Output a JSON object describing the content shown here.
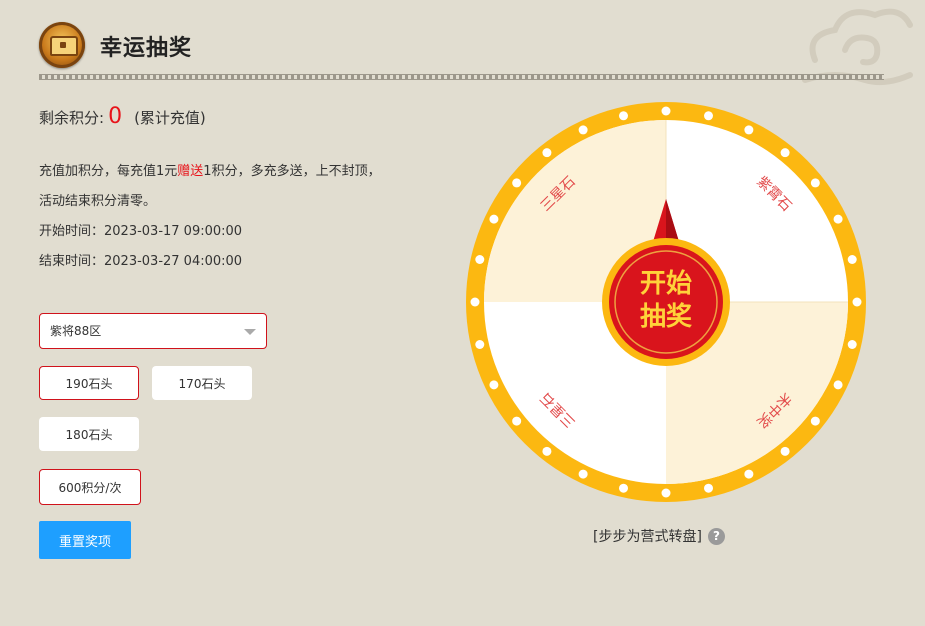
{
  "header": {
    "title": "幸运抽奖",
    "icon": "treasure-chest-icon"
  },
  "points": {
    "label": "剩余积分:",
    "value": "0",
    "note": "(累计充值)"
  },
  "rules": {
    "line1_a": "充值加积分，每充值1元",
    "line1_highlight": "赠送",
    "line1_b": "1积分，多充多送，上不封顶，",
    "line2": "活动结束积分清零。",
    "start_time": "开始时间：2023-03-17 09:00:00",
    "end_time": "结束时间：2023-03-27 04:00:00"
  },
  "server_select": {
    "value": "紫将88区"
  },
  "options": [
    {
      "label": "190石头",
      "selected": true
    },
    {
      "label": "170石头",
      "selected": false
    },
    {
      "label": "180石头",
      "selected": false
    }
  ],
  "cost": {
    "label": "600积分/次"
  },
  "reset_button": {
    "label": "重置奖项"
  },
  "wheel": {
    "prizes": [
      "三星石",
      "紫霄石",
      "未中奖",
      "三星石"
    ],
    "start_line1": "开始",
    "start_line2": "抽奖",
    "caption": "[步步为营式转盘]",
    "help": "?"
  },
  "colors": {
    "accent": "#e8131a",
    "ring": "#fcb811",
    "button_blue": "#1e9fff",
    "segment_cream": "#fdf2d8"
  }
}
